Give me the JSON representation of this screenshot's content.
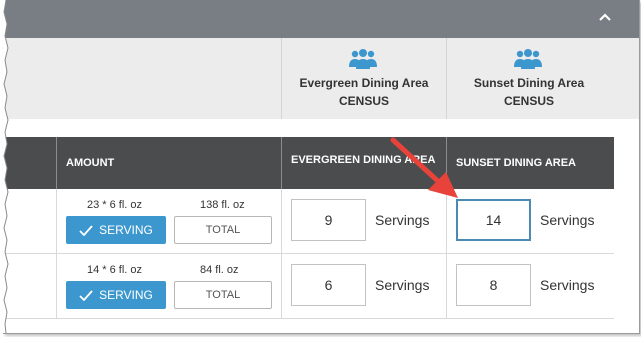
{
  "header": {
    "collapse_icon": "chevron-up-icon"
  },
  "census": {
    "columns": [
      {
        "name": "Evergreen Dining Area",
        "sub": "CENSUS",
        "icon": "people-group-icon"
      },
      {
        "name": "Sunset Dining Area",
        "sub": "CENSUS",
        "icon": "people-group-icon"
      }
    ],
    "icon_color": "#3d97cf"
  },
  "table": {
    "headers": {
      "amount": "AMOUNT",
      "evergreen": "EVERGREEN DINING AREA",
      "sunset": "SUNSET DINING AREA"
    },
    "rows": [
      {
        "per_serving": "23 * 6 fl. oz",
        "total_amount": "138 fl. oz",
        "serving_button": "SERVING",
        "total_button": "TOTAL",
        "evergreen_value": "9",
        "evergreen_unit": "Servings",
        "sunset_value": "14",
        "sunset_unit": "Servings"
      },
      {
        "per_serving": "14 * 6 fl. oz",
        "total_amount": "84 fl. oz",
        "serving_button": "SERVING",
        "total_button": "TOTAL",
        "evergreen_value": "6",
        "evergreen_unit": "Servings",
        "sunset_value": "8",
        "sunset_unit": "Servings"
      }
    ]
  },
  "colors": {
    "header_bar": "#787e83",
    "table_header": "#4a4c4e",
    "accent": "#3d97cf",
    "focused_border": "#4a8ab4",
    "arrow": "#e8433a"
  }
}
